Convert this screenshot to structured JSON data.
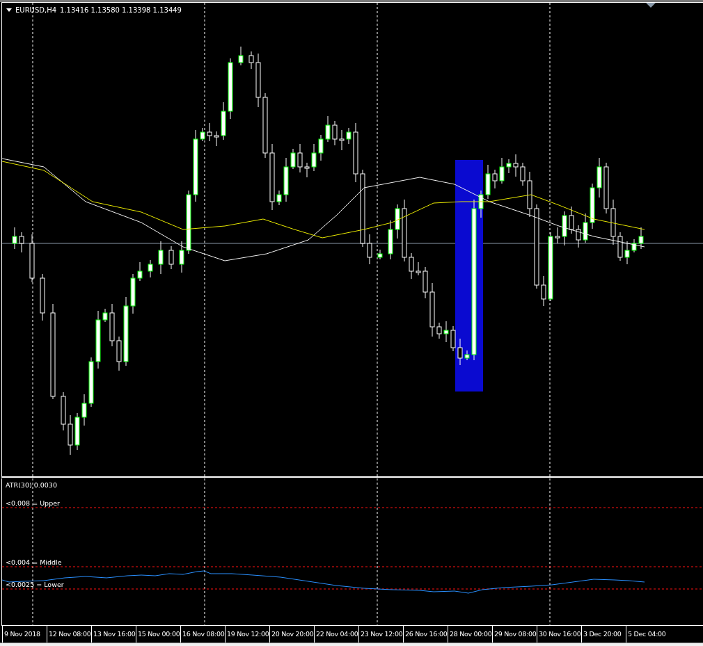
{
  "chart_header": {
    "symbol": "EURUSD,H4",
    "prices": "1.13416 1.13580 1.13398 1.13449"
  },
  "indicator": {
    "title": "ATR(30) 0.0030",
    "levels": [
      {
        "label": "<0.008 = Upper"
      },
      {
        "label": "<0.004 = Middle"
      },
      {
        "label": "<0.0025 = Lower"
      }
    ]
  },
  "time_axis": [
    "9 Nov 2018",
    "12 Nov 08:00",
    "13 Nov 16:00",
    "15 Nov 00:00",
    "16 Nov 08:00",
    "19 Nov 12:00",
    "20 Nov 20:00",
    "22 Nov 04:00",
    "23 Nov 12:00",
    "26 Nov 16:00",
    "28 Nov 00:00",
    "29 Nov 08:00",
    "30 Nov 16:00",
    "3 Dec 20:00",
    "5 Dec 04:00"
  ]
}
